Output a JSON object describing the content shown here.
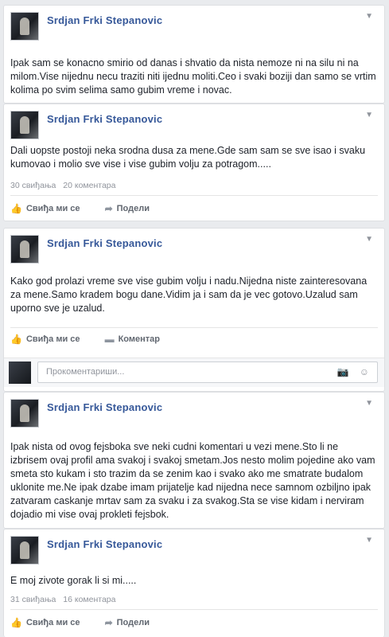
{
  "posts": [
    {
      "author": "Srdjan Frki Stepanovic",
      "text": "Ipak sam se konacno smirio od danas i shvatio da nista nemoze ni na silu ni na milom.Vise nijednu necu traziti niti ijednu moliti.Ceo i svaki boziji dan samo se vrtim kolima po svim selima samo gubim vreme i novac."
    },
    {
      "author": "Srdjan Frki Stepanovic",
      "text": "Dali uopste postoji neka srodna dusa za mene.Gde sam sam se sve isao i svaku kumovao i molio sve vise i vise gubim volju za potragom.....",
      "likes": "30 свиђања",
      "comments": "20 коментара",
      "actions": [
        "Свиђа ми се",
        "Подели"
      ]
    },
    {
      "author": "Srdjan Frki Stepanovic",
      "text": "Kako god prolazi vreme sve vise gubim volju i nadu.Nijedna niste zainteresovana za mene.Samo kradem bogu dane.Vidim ja i sam da je vec gotovo.Uzalud sam uporno sve je uzalud.",
      "actions": [
        "Свиђа ми се",
        "Коментар"
      ],
      "comment_placeholder": "Прокоментариши..."
    },
    {
      "author": "Srdjan Frki Stepanovic",
      "text": "Ipak nista od ovog fejsboka sve neki cudni komentari u vezi mene.Sto li ne izbrisem ovaj profil ama svakoj i svakoj smetam.Jos nesto molim pojedine ako vam smeta sto kukam i sto trazim da se zenim kao i svako ako me smatrate budalom uklonite me.Ne ipak dzabe imam prijatelje kad nijedna nece samnom ozbiljno ipak zatvaram caskanje mrtav sam za svaku i za svakog.Sta se vise kidam i nerviram dojadio mi vise ovaj prokleti fejsbok."
    },
    {
      "author": "Srdjan Frki Stepanovic",
      "text": "E moj zivote gorak li si mi.....",
      "likes": "31 свиђања",
      "comments": "16 коментара",
      "actions": [
        "Свиђа ми се",
        "Подели"
      ]
    }
  ],
  "icons": {
    "like": "thumbs-up-icon",
    "share": "share-arrow-icon",
    "comment": "comment-bubble-icon",
    "camera": "camera-icon",
    "emoji": "smiley-icon",
    "menu": "chevron-down-icon"
  },
  "colors": {
    "author_link": "#365899",
    "background": "#e9ebee"
  }
}
